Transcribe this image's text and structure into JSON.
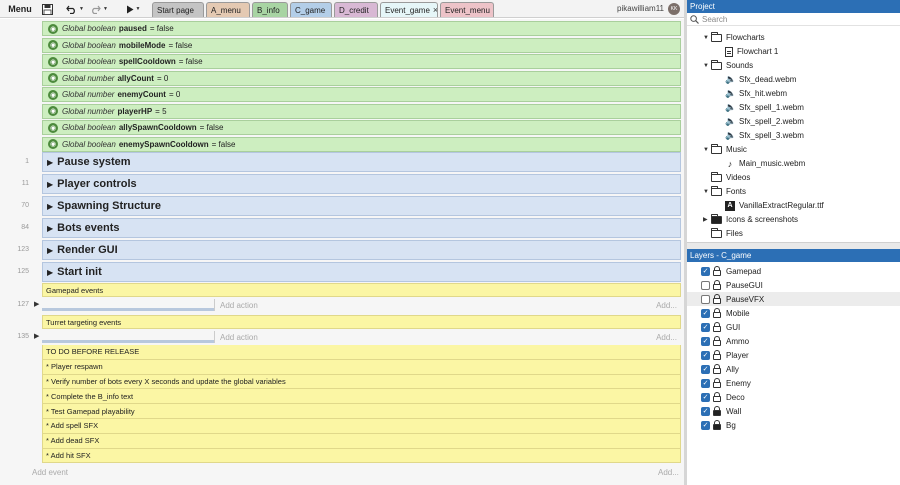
{
  "toolbar": {
    "menu_label": "Menu",
    "tabs": [
      {
        "label": "Start page",
        "closable": false,
        "color": "#c4c4c4"
      },
      {
        "label": "A_menu",
        "closable": false,
        "color": "#e4c9b2"
      },
      {
        "label": "B_info",
        "closable": false,
        "color": "#a8d4a3"
      },
      {
        "label": "C_game",
        "closable": false,
        "color": "#b3cee8"
      },
      {
        "label": "D_credit",
        "closable": false,
        "color": "#d8b8d4"
      },
      {
        "label": "Event_game",
        "closable": true,
        "color": "#e6f6f8"
      },
      {
        "label": "Event_menu",
        "closable": true,
        "color": "#edc3c8"
      }
    ],
    "user_name": "pikawilliam11",
    "avatar_text": "KK"
  },
  "variables": [
    {
      "scope": "Global boolean",
      "name": "paused",
      "value": "= false"
    },
    {
      "scope": "Global boolean",
      "name": "mobileMode",
      "value": "= false"
    },
    {
      "scope": "Global boolean",
      "name": "spellCooldown",
      "value": "= false"
    },
    {
      "scope": "Global number",
      "name": "allyCount",
      "value": "= 0"
    },
    {
      "scope": "Global number",
      "name": "enemyCount",
      "value": "= 0"
    },
    {
      "scope": "Global number",
      "name": "playerHP",
      "value": "= 5"
    },
    {
      "scope": "Global boolean",
      "name": "allySpawnCooldown",
      "value": "= false"
    },
    {
      "scope": "Global boolean",
      "name": "enemySpawnCooldown",
      "value": "= false"
    }
  ],
  "groups": [
    {
      "line": "1",
      "title": "Pause system"
    },
    {
      "line": "11",
      "title": "Player controls"
    },
    {
      "line": "70",
      "title": "Spawning Structure"
    },
    {
      "line": "84",
      "title": "Bots events"
    },
    {
      "line": "123",
      "title": "Render GUI"
    },
    {
      "line": "125",
      "title": "Start init"
    }
  ],
  "comment_blocks": [
    {
      "line": "127",
      "title": "Gamepad events"
    },
    {
      "line": "135",
      "title": "Turret targeting events"
    }
  ],
  "add_action_label": "Add action",
  "add_more_label": "Add...",
  "todo_lines": [
    "TO DO BEFORE RELEASE",
    "* Player respawn",
    "* Verify number of bots every X seconds and update the global variables",
    "* Complete the B_info text",
    "* Test Gamepad playability",
    "* Add spell SFX",
    "* Add dead SFX",
    "* Add hit SFX"
  ],
  "add_event_label": "Add event",
  "project": {
    "header": "Project",
    "search_placeholder": "Search",
    "items": [
      {
        "label": "Flowcharts",
        "kind": "folder"
      },
      {
        "label": "Flowchart 1",
        "kind": "doc"
      },
      {
        "label": "Sounds",
        "kind": "folder"
      },
      {
        "label": "Sfx_dead.webm",
        "kind": "sound"
      },
      {
        "label": "Sfx_hit.webm",
        "kind": "sound"
      },
      {
        "label": "Sfx_spell_1.webm",
        "kind": "sound"
      },
      {
        "label": "Sfx_spell_2.webm",
        "kind": "sound"
      },
      {
        "label": "Sfx_spell_3.webm",
        "kind": "sound"
      },
      {
        "label": "Music",
        "kind": "folder"
      },
      {
        "label": "Main_music.webm",
        "kind": "music"
      },
      {
        "label": "Videos",
        "kind": "folder"
      },
      {
        "label": "Fonts",
        "kind": "folder"
      },
      {
        "label": "VanillaExtractRegular.ttf",
        "kind": "font"
      },
      {
        "label": "Icons & screenshots",
        "kind": "folder"
      },
      {
        "label": "Files",
        "kind": "folder"
      }
    ]
  },
  "layers": {
    "header": "Layers - C_game",
    "items": [
      {
        "label": "Gamepad",
        "visible": true,
        "locked": false
      },
      {
        "label": "PauseGUI",
        "visible": false,
        "locked": false
      },
      {
        "label": "PauseVFX",
        "visible": false,
        "locked": false
      },
      {
        "label": "Mobile",
        "visible": true,
        "locked": false
      },
      {
        "label": "GUI",
        "visible": true,
        "locked": false
      },
      {
        "label": "Ammo",
        "visible": true,
        "locked": false
      },
      {
        "label": "Player",
        "visible": true,
        "locked": false
      },
      {
        "label": "Ally",
        "visible": true,
        "locked": false
      },
      {
        "label": "Enemy",
        "visible": true,
        "locked": false
      },
      {
        "label": "Deco",
        "visible": true,
        "locked": false
      },
      {
        "label": "Wall",
        "visible": true,
        "locked": true
      },
      {
        "label": "Bg",
        "visible": true,
        "locked": true
      }
    ]
  }
}
